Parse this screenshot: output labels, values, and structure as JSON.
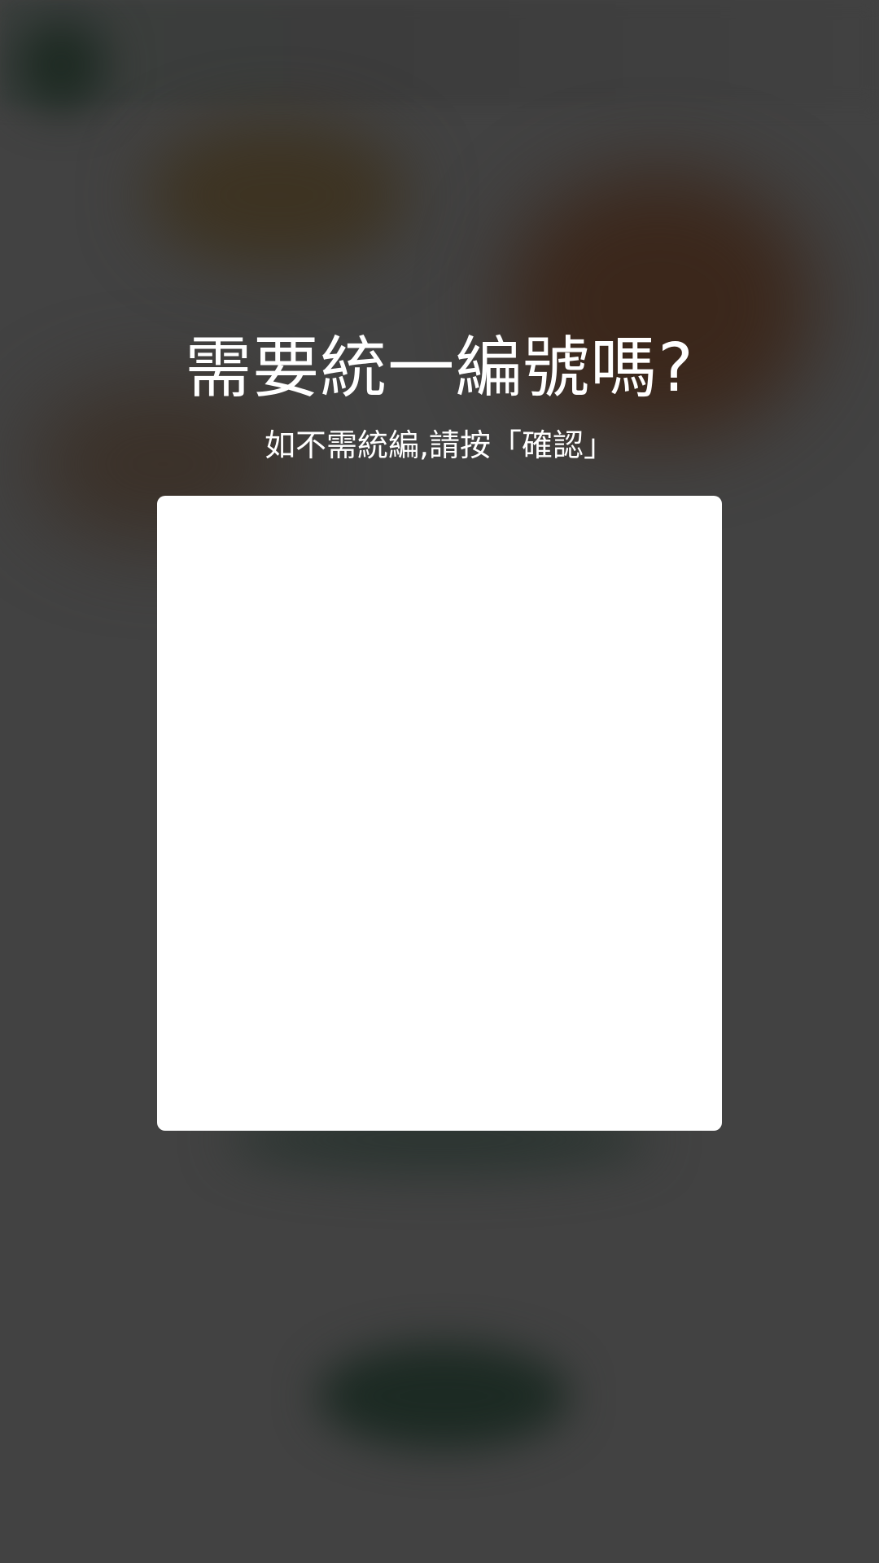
{
  "dialog": {
    "title": "需要統一編號嗎?",
    "subtitle": "如不需統編,請按「確認」"
  },
  "colors": {
    "overlay": "#3f3f3f",
    "panel": "#ffffff",
    "text": "#ffffff"
  }
}
